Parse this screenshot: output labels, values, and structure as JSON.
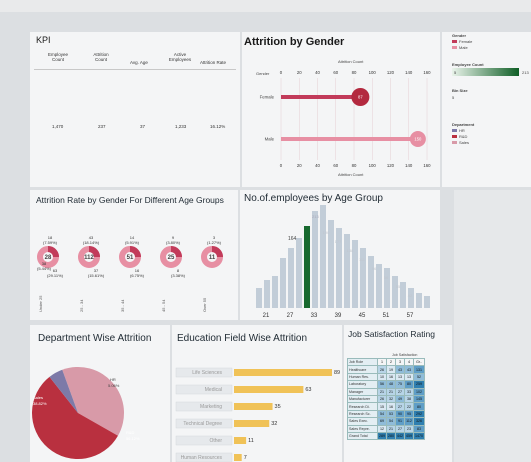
{
  "colors": {
    "female": "#c23b5a",
    "male": "#e78fa3",
    "emp_bar_dark": "#17692f",
    "emp_bar_light": "#b8c6d2",
    "edu_bar": "#f0c257",
    "pie_sales": "#d89aa8",
    "pie_rd": "#b9303f",
    "pie_hr": "#7d7aa8"
  },
  "kpi": {
    "title": "KPI",
    "headers": [
      "Employee Count",
      "Attrition Count",
      "Avg. Age",
      "Active Employees",
      "Attrition Rate"
    ],
    "values": [
      "1,470",
      "237",
      "37",
      "1,233",
      "16.12%"
    ]
  },
  "gender": {
    "title": "Attrition by Gender",
    "axis_top": "Attrition Count",
    "axis_bottom": "Attrition Count",
    "row_header": "Gender",
    "ticks": [
      "0",
      "20",
      "40",
      "60",
      "80",
      "100",
      "120",
      "140",
      "160"
    ],
    "rows": [
      {
        "label": "Female",
        "value": 87
      },
      {
        "label": "Male",
        "value": 150
      }
    ],
    "bubble_labels": [
      "87",
      "150"
    ]
  },
  "legend": {
    "gender_title": "Gender",
    "gender_items": [
      "Female",
      "Male"
    ],
    "emp_count_title": "Employee Count",
    "emp_min": "5",
    "emp_max": "213",
    "bin_title": "Bin Size",
    "bin_value": "5",
    "dept_title": "Department",
    "dept_items": [
      "HR",
      "R&D",
      "Sales"
    ]
  },
  "age_attr": {
    "title": "Attrition Rate by Gender For Different Age Groups",
    "groups": [
      {
        "label": "Under 25",
        "center": "28",
        "female": "18",
        "female_pct": "(7.59%)",
        "male": "63",
        "male_pct": "(29.11%)",
        "left": "38",
        "left_pct": "(5.44%)"
      },
      {
        "label": "25 - 34",
        "center": "112",
        "female": "43",
        "female_pct": "(18.14%)",
        "male": "37",
        "male_pct": "(15.61%)"
      },
      {
        "label": "35 - 44",
        "center": "51",
        "female": "14",
        "female_pct": "(5.91%)",
        "male": "16",
        "male_pct": "(6.75%)"
      },
      {
        "label": "45 - 54",
        "center": "25",
        "female": "9",
        "female_pct": "(3.80%)",
        "male": "8",
        "male_pct": "(3.38%)"
      },
      {
        "label": "Over 55",
        "center": "11",
        "female": "3",
        "female_pct": "(1.27%)",
        "male": "",
        "male_pct": ""
      }
    ]
  },
  "emp_age": {
    "title": "No.of.employees by Age Group",
    "ticks": [
      "21",
      "27",
      "33",
      "39",
      "45",
      "51",
      "57"
    ],
    "value_label": "164",
    "peak_label": "213",
    "labels_light": [
      "190",
      "177",
      "138",
      "111",
      "96",
      "56",
      "55",
      "42"
    ]
  },
  "dept": {
    "title": "Department Wise Attrition",
    "slices": [
      {
        "name": "Sales",
        "pct": "38.82%",
        "value": 38.82
      },
      {
        "name": "R&D",
        "pct": "56.12%",
        "value": 56.12
      },
      {
        "name": "HR",
        "pct": "5.06%",
        "value": 5.06
      }
    ]
  },
  "edu": {
    "title": "Education Field Wise Attrition",
    "items": [
      {
        "field": "Life Sciences",
        "value": 89
      },
      {
        "field": "Medical",
        "value": 63
      },
      {
        "field": "Marketing",
        "value": 35
      },
      {
        "field": "Technical Degree",
        "value": 32
      },
      {
        "field": "Other",
        "value": 11
      },
      {
        "field": "Human Resources",
        "value": 7
      }
    ]
  },
  "job": {
    "title": "Job Satisfaction Rating",
    "header_role": "Job Role",
    "header_group": "Job Satisfaction",
    "cols": [
      "1",
      "2",
      "3",
      "4",
      "Gr.."
    ],
    "rows": [
      {
        "role": "Healthcare",
        "vals": [
          "26",
          "19",
          "43",
          "43",
          "131"
        ]
      },
      {
        "role": "Human Res.",
        "vals": [
          "10",
          "16",
          "13",
          "13",
          "52"
        ]
      },
      {
        "role": "Laboratory",
        "vals": [
          "56",
          "48",
          "75",
          "80",
          "259"
        ]
      },
      {
        "role": "Manager",
        "vals": [
          "21",
          "21",
          "27",
          "33",
          "102"
        ]
      },
      {
        "role": "Manufacturer",
        "vals": [
          "26",
          "32",
          "49",
          "38",
          "145"
        ]
      },
      {
        "role": "Research Di.",
        "vals": [
          "15",
          "16",
          "27",
          "22",
          "80"
        ]
      },
      {
        "role": "Research Sc.",
        "vals": [
          "54",
          "53",
          "90",
          "95",
          "292"
        ]
      },
      {
        "role": "Sales Exec.",
        "vals": [
          "69",
          "54",
          "91",
          "112",
          "326"
        ]
      },
      {
        "role": "Sales Repre.",
        "vals": [
          "12",
          "21",
          "27",
          "23",
          "83"
        ]
      },
      {
        "role": "Grand Total",
        "vals": [
          "289",
          "280",
          "442",
          "459",
          "1470"
        ]
      }
    ]
  }
}
